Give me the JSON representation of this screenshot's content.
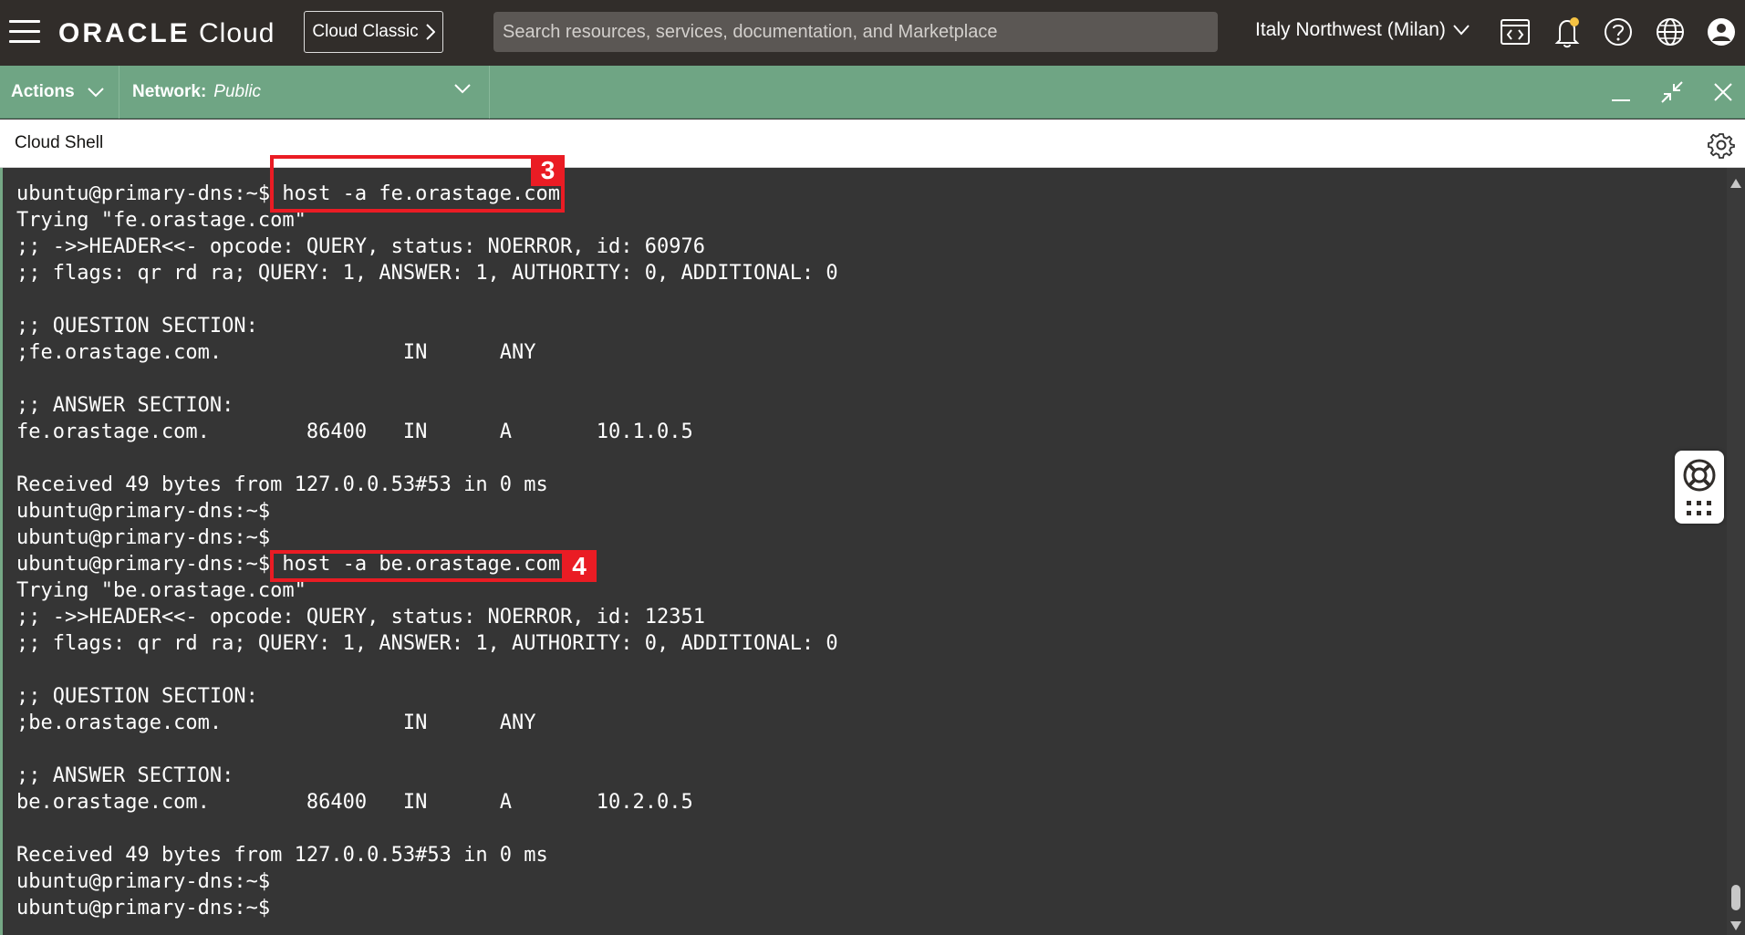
{
  "header": {
    "logo_brand": "ORACLE",
    "logo_product": "Cloud",
    "classic_button": "Cloud Classic",
    "search_placeholder": "Search resources, services, documentation, and Marketplace",
    "region": "Italy Northwest (Milan)",
    "icons": [
      "code-editor-icon",
      "bell-icon",
      "help-icon",
      "globe-icon",
      "user-icon"
    ],
    "notification_dot_color": "#f5c243"
  },
  "action_bar": {
    "actions_label": "Actions",
    "network_label": "Network:",
    "network_value": "Public",
    "background_color": "#6fa584"
  },
  "shell": {
    "title": "Cloud Shell"
  },
  "terminal": {
    "lines": [
      "ubuntu@primary-dns:~$ host -a fe.orastage.com",
      "Trying \"fe.orastage.com\"",
      ";; ->>HEADER<<- opcode: QUERY, status: NOERROR, id: 60976",
      ";; flags: qr rd ra; QUERY: 1, ANSWER: 1, AUTHORITY: 0, ADDITIONAL: 0",
      "",
      ";; QUESTION SECTION:",
      ";fe.orastage.com.               IN      ANY",
      "",
      ";; ANSWER SECTION:",
      "fe.orastage.com.        86400   IN      A       10.1.0.5",
      "",
      "Received 49 bytes from 127.0.0.53#53 in 0 ms",
      "ubuntu@primary-dns:~$",
      "ubuntu@primary-dns:~$",
      "ubuntu@primary-dns:~$ host -a be.orastage.com",
      "Trying \"be.orastage.com\"",
      ";; ->>HEADER<<- opcode: QUERY, status: NOERROR, id: 12351",
      ";; flags: qr rd ra; QUERY: 1, ANSWER: 1, AUTHORITY: 0, ADDITIONAL: 0",
      "",
      ";; QUESTION SECTION:",
      ";be.orastage.com.               IN      ANY",
      "",
      ";; ANSWER SECTION:",
      "be.orastage.com.        86400   IN      A       10.2.0.5",
      "",
      "Received 49 bytes from 127.0.0.53#53 in 0 ms",
      "ubuntu@primary-dns:~$",
      "ubuntu@primary-dns:~$"
    ]
  },
  "annotations": {
    "step_3": "3",
    "step_4": "4",
    "color": "#ea1c24"
  }
}
